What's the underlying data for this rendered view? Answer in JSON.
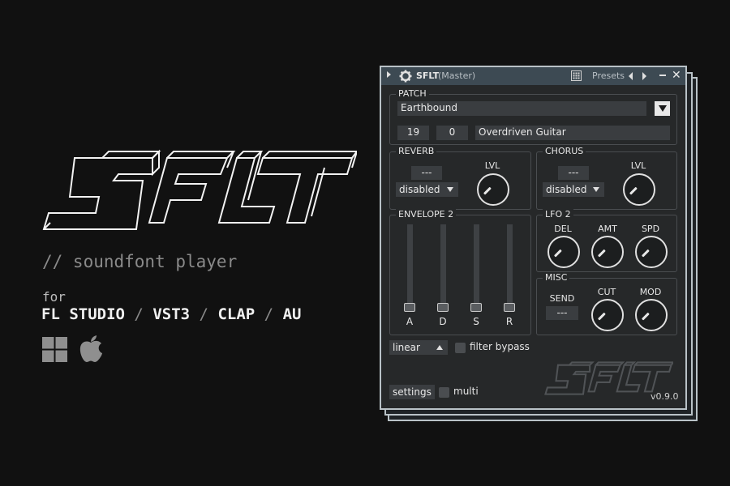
{
  "promo": {
    "tagline": "// soundfont player",
    "for_label": "for",
    "platforms": [
      "FL STUDIO",
      "VST3",
      "CLAP",
      "AU"
    ],
    "separator": "/",
    "os_icons": [
      "windows-icon",
      "apple-icon"
    ]
  },
  "window": {
    "title": "SFLT",
    "subtitle": "(Master)",
    "presets_label": "Presets",
    "close_glyph": "✕"
  },
  "patch": {
    "label": "PATCH",
    "bank_name": "Earthbound",
    "bank": "19",
    "program": "0",
    "program_name": "Overdriven Guitar"
  },
  "reverb": {
    "label": "REVERB",
    "value": "---",
    "mode": "disabled",
    "level_label": "LVL"
  },
  "chorus": {
    "label": "CHORUS",
    "value": "---",
    "mode": "disabled",
    "level_label": "LVL"
  },
  "envelope": {
    "label": "ENVELOPE 2",
    "sliders": [
      {
        "label": "A",
        "level": 0.0
      },
      {
        "label": "D",
        "level": 0.0
      },
      {
        "label": "S",
        "level": 0.0
      },
      {
        "label": "R",
        "level": 0.0
      }
    ]
  },
  "lfo": {
    "label": "LFO 2",
    "knobs": [
      "DEL",
      "AMT",
      "SPD"
    ]
  },
  "misc": {
    "label": "MISC",
    "send_label": "SEND",
    "send_value": "---",
    "knobs": [
      "CUT",
      "MOD"
    ]
  },
  "footer": {
    "curve": "linear",
    "filter_bypass_label": "filter bypass",
    "settings_label": "settings",
    "multi_label": "multi",
    "version": "v0.9.0"
  },
  "colors": {
    "background": "#111111",
    "panel": "#262829",
    "titlebar": "#3d4a53",
    "border": "#b9c2c7",
    "field": "#3a3d40"
  }
}
